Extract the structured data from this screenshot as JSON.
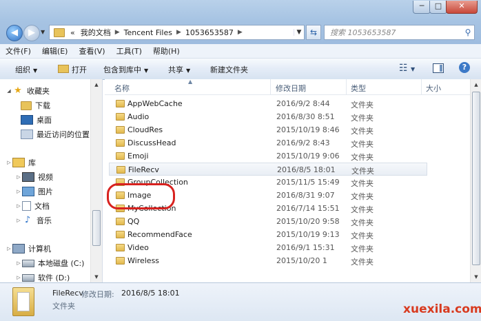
{
  "window": {
    "buttons": {
      "minimize": "─",
      "maximize": "□",
      "close": "✕"
    }
  },
  "address_bar": {
    "overflow": "«",
    "segments": [
      "我的文档",
      "Tencent Files",
      "1053653587"
    ]
  },
  "search": {
    "placeholder": "搜索 1053653587"
  },
  "menu": [
    "文件(F)",
    "编辑(E)",
    "查看(V)",
    "工具(T)",
    "帮助(H)"
  ],
  "toolbar": {
    "organize": "组织",
    "open": "打开",
    "include_library": "包含到库中",
    "share": "共享",
    "new_folder": "新建文件夹"
  },
  "nav": {
    "favorites": {
      "label": "收藏夹",
      "items": [
        "下载",
        "桌面",
        "最近访问的位置"
      ]
    },
    "libraries": {
      "label": "库",
      "items": [
        "视频",
        "图片",
        "文档",
        "音乐"
      ]
    },
    "computer": {
      "label": "计算机",
      "items": [
        "本地磁盘 (C:)",
        "软件 (D:)"
      ]
    }
  },
  "columns": {
    "name": "名称",
    "date": "修改日期",
    "type": "类型",
    "size": "大小"
  },
  "files": [
    {
      "name": "AppWebCache",
      "date": "2016/9/2 8:44",
      "type": "文件夹"
    },
    {
      "name": "Audio",
      "date": "2016/8/30 8:51",
      "type": "文件夹"
    },
    {
      "name": "CloudRes",
      "date": "2015/10/19 8:46",
      "type": "文件夹"
    },
    {
      "name": "DiscussHead",
      "date": "2016/9/2 8:43",
      "type": "文件夹"
    },
    {
      "name": "Emoji",
      "date": "2015/10/19 9:06",
      "type": "文件夹"
    },
    {
      "name": "FileRecv",
      "date": "2016/8/5 18:01",
      "type": "文件夹",
      "selected": true
    },
    {
      "name": "GroupCollection",
      "date": "2015/11/5 15:49",
      "type": "文件夹"
    },
    {
      "name": "Image",
      "date": "2016/8/31 9:07",
      "type": "文件夹"
    },
    {
      "name": "MyCollection",
      "date": "2016/7/14 15:51",
      "type": "文件夹"
    },
    {
      "name": "QQ",
      "date": "2015/10/20 9:58",
      "type": "文件夹"
    },
    {
      "name": "RecommendFace",
      "date": "2015/10/19 9:13",
      "type": "文件夹"
    },
    {
      "name": "Video",
      "date": "2016/9/1 15:31",
      "type": "文件夹"
    },
    {
      "name": "Wireless",
      "date": "2015/10/20 1",
      "type": "文件夹"
    }
  ],
  "details": {
    "name": "FileRecv",
    "date_label": "修改日期:",
    "date": "2016/8/5 18:01",
    "type": "文件夹"
  },
  "watermark": "xuexila.com",
  "highlight_color": "#d8221f"
}
